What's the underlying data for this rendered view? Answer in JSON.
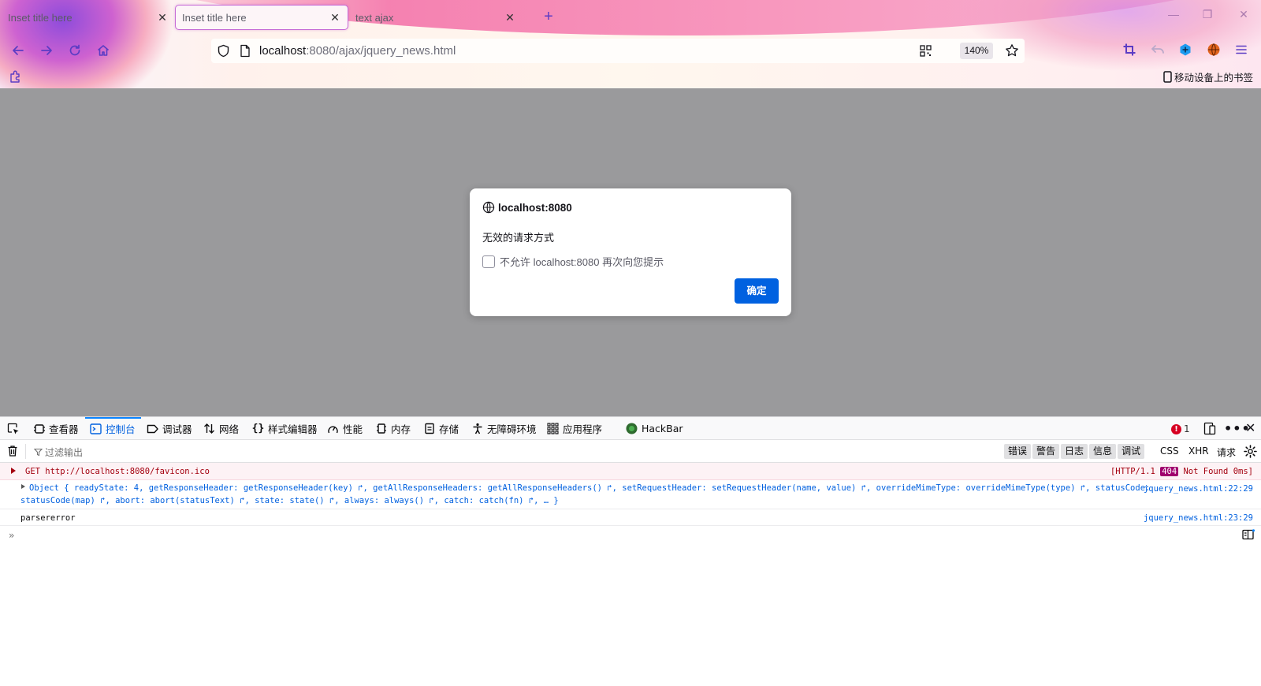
{
  "browser": {
    "tabs": [
      {
        "title": "Inset title here",
        "active": false
      },
      {
        "title": "Inset title here",
        "active": true
      },
      {
        "title": "text ajax",
        "active": false
      }
    ],
    "new_tab_label": "+",
    "url": {
      "host": "localhost",
      "path": ":8080/ajax/jquery_news.html"
    },
    "zoom": "140%",
    "bookmark_mobile": "移动设备上的书签"
  },
  "dialog": {
    "origin": "localhost:8080",
    "message": "无效的请求方式",
    "checkbox_label": "不允许 localhost:8080 再次向您提示",
    "ok_label": "确定"
  },
  "devtools": {
    "tabs": [
      {
        "label": "查看器",
        "icon": "inspector-icon"
      },
      {
        "label": "控制台",
        "icon": "console-icon",
        "active": true
      },
      {
        "label": "调试器",
        "icon": "debugger-icon"
      },
      {
        "label": "网络",
        "icon": "network-icon"
      },
      {
        "label": "样式编辑器",
        "icon": "style-editor-icon"
      },
      {
        "label": "性能",
        "icon": "performance-icon"
      },
      {
        "label": "内存",
        "icon": "memory-icon"
      },
      {
        "label": "存储",
        "icon": "storage-icon"
      },
      {
        "label": "无障碍环境",
        "icon": "accessibility-icon"
      },
      {
        "label": "应用程序",
        "icon": "application-icon"
      },
      {
        "label": "HackBar",
        "icon": "hackbar-icon"
      }
    ],
    "error_count": "1",
    "filter_placeholder": "过滤输出",
    "levels": [
      "错误",
      "警告",
      "日志",
      "信息",
      "调试"
    ],
    "types": [
      "CSS",
      "XHR",
      "请求"
    ],
    "console": {
      "error_row": {
        "text": "GET http://localhost:8080/favicon.ico",
        "status_prefix": "[HTTP/1.1",
        "status_code": "404",
        "status_suffix": "Not Found 0ms]"
      },
      "object_row": {
        "line1": "Object { readyState: 4, getResponseHeader: getResponseHeader(key) ↱, getAllResponseHeaders: getAllResponseHeaders() ↱, setRequestHeader: setRequestHeader(name, value) ↱, overrideMimeType: overrideMimeType(type) ↱, statusCode:",
        "line2": "statusCode(map) ↱, abort: abort(statusText) ↱, state: state() ↱, always: always() ↱, catch: catch(fn) ↱, … }",
        "source": "jquery_news.html:22:29"
      },
      "plain_row": {
        "text": "parsererror",
        "source": "jquery_news.html:23:29"
      }
    }
  },
  "colors": {
    "accent": "#0061e0",
    "devtools_active": "#0a84ff",
    "error_text": "#a4000f",
    "overlay": "#9a9a9c"
  }
}
